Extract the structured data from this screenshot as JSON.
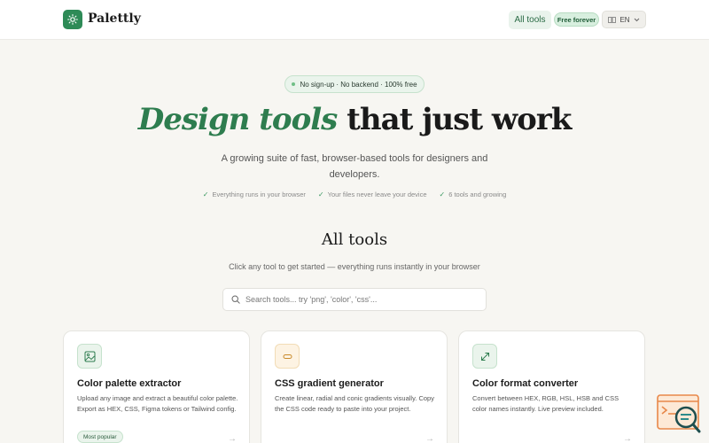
{
  "header": {
    "brand": "Palettly",
    "nav_all_tools": "All tools",
    "badge_free": "Free forever",
    "lang_label": "EN"
  },
  "hero": {
    "pill": "No sign-up · No backend · 100% free",
    "title_accent": "Design tools",
    "title_rest": " that just work",
    "subtitle": "A growing suite of fast, browser-based tools for designers and developers.",
    "checks": [
      "Everything runs in your browser",
      "Your files never leave your device",
      "6 tools and growing"
    ]
  },
  "tools_section": {
    "title": "All tools",
    "subtitle": "Click any tool to get started — everything runs instantly in your browser",
    "search_placeholder": "Search tools... try 'png', 'color', 'css'..."
  },
  "cards": [
    {
      "title": "Color palette extractor",
      "description": "Upload any image and extract a beautiful color palette. Export as HEX, CSS, Figma tokens or Tailwind config.",
      "badge": "Most popular",
      "icon": "image-icon"
    },
    {
      "title": "CSS gradient generator",
      "description": "Create linear, radial and conic gradients visually. Copy the CSS code ready to paste into your project.",
      "icon": "gradient-icon"
    },
    {
      "title": "Color format converter",
      "description": "Convert between HEX, RGB, HSL, HSB and CSS color names instantly. Live preview included.",
      "icon": "convert-arrow-icon"
    }
  ],
  "colors": {
    "accent": "#2e7d4f",
    "background": "#f7f6f2",
    "card": "#ffffff"
  }
}
